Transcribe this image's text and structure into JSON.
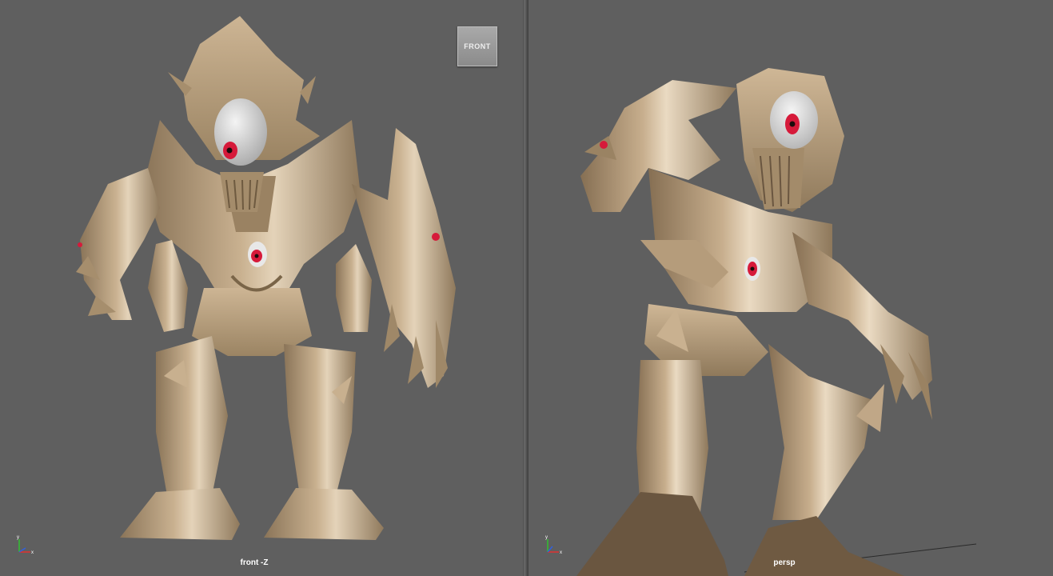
{
  "viewports": {
    "front": {
      "label": "front -Z",
      "view_cube_label": "FRONT"
    },
    "persp": {
      "label": "persp"
    }
  },
  "colors": {
    "viewport_background": "#5f5f5f",
    "model_skin": "#bba282",
    "model_shadow": "#8a7458",
    "model_highlight": "#ecdcc4",
    "eye_white": "#e8e8e8",
    "iris": "#d61a3a",
    "axis_x": "#e03030",
    "axis_y": "#30c030",
    "axis_z": "#3060e0"
  },
  "icons": [
    "axis-gizmo-icon",
    "view-cube-icon"
  ]
}
